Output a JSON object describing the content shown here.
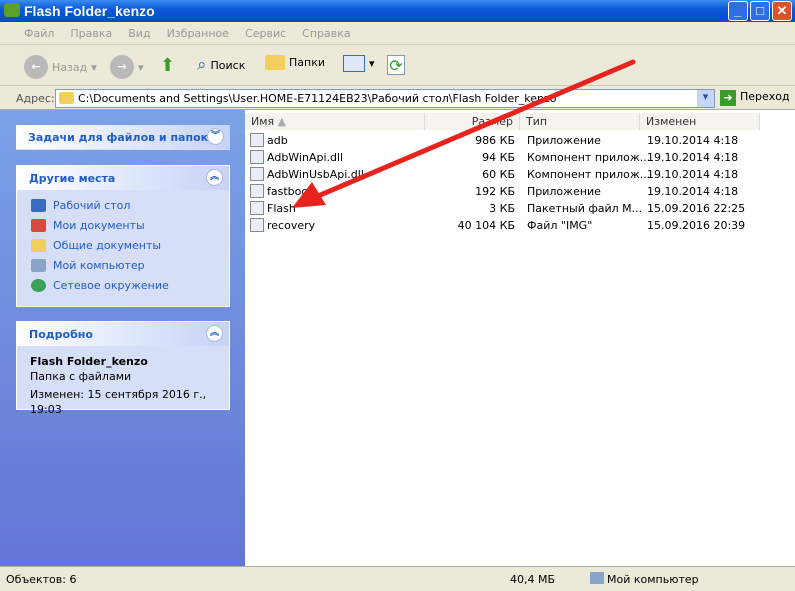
{
  "window": {
    "title": "Flash Folder_kenzo"
  },
  "menu": [
    "Файл",
    "Правка",
    "Вид",
    "Избранное",
    "Сервис",
    "Справка"
  ],
  "toolbar": {
    "back": "Назад",
    "search": "Поиск",
    "folders": "Папки"
  },
  "address": {
    "label": "Адрес:",
    "path": "C:\\Documents and Settings\\User.HOME-E71124EB23\\Рабочий стол\\Flash Folder_kenzo",
    "go": "Переход"
  },
  "tasks": {
    "title": "Задачи для файлов и папок"
  },
  "places": {
    "title": "Другие места",
    "items": [
      "Рабочий стол",
      "Мои документы",
      "Общие документы",
      "Мой компьютер",
      "Сетевое окружение"
    ]
  },
  "details": {
    "title": "Подробно",
    "name": "Flash Folder_kenzo",
    "type": "Папка с файлами",
    "modified": "Изменен: 15 сентября 2016 г., 19:03"
  },
  "columns": [
    "Имя",
    "Размер",
    "Тип",
    "Изменен"
  ],
  "files": [
    {
      "name": "adb",
      "size": "986 КБ",
      "type": "Приложение",
      "date": "19.10.2014 4:18"
    },
    {
      "name": "AdbWinApi.dll",
      "size": "94 КБ",
      "type": "Компонент прилож...",
      "date": "19.10.2014 4:18"
    },
    {
      "name": "AdbWinUsbApi.dll",
      "size": "60 КБ",
      "type": "Компонент прилож...",
      "date": "19.10.2014 4:18"
    },
    {
      "name": "fastboot",
      "size": "192 КБ",
      "type": "Приложение",
      "date": "19.10.2014 4:18"
    },
    {
      "name": "Flash",
      "size": "3 КБ",
      "type": "Пакетный файл M...",
      "date": "15.09.2016 22:25"
    },
    {
      "name": "recovery",
      "size": "40 104 КБ",
      "type": "Файл \"IMG\"",
      "date": "15.09.2016 20:39"
    }
  ],
  "status": {
    "objects": "Объектов: 6",
    "size": "40,4 МБ",
    "location": "Мой компьютер"
  }
}
